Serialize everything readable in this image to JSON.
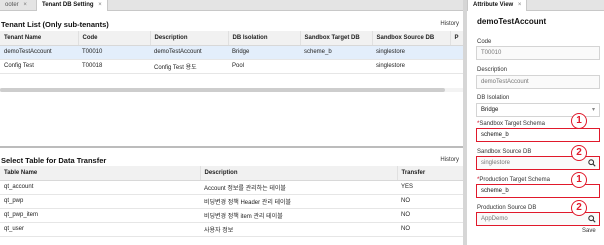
{
  "tabs": [
    {
      "label": "ooter",
      "active": false
    },
    {
      "label": "Tenant DB Setting",
      "active": true
    }
  ],
  "tenant_list": {
    "title": "Tenant List (Only sub-tenants)",
    "history_label": "History",
    "columns": [
      "Tenant Name",
      "Code",
      "Description",
      "DB Isolation",
      "Sandbox Target DB",
      "Sandbox Source DB",
      "P"
    ],
    "rows": [
      {
        "name": "demoTestAccount",
        "code": "T00010",
        "description": "demoTestAccount",
        "isolation": "Bridge",
        "sandbox_target": "scheme_b",
        "sandbox_source": "singlestore",
        "p": "",
        "selected": true
      },
      {
        "name": "Config Test",
        "code": "T00018",
        "description": "Config Test 용도",
        "isolation": "Pool",
        "sandbox_target": "",
        "sandbox_source": "singlestore",
        "p": "",
        "selected": false
      }
    ]
  },
  "transfer_tables": {
    "title": "Select Table for Data Transfer",
    "history_label": "History",
    "columns": [
      "Table Name",
      "Description",
      "Transfer"
    ],
    "rows": [
      {
        "name": "qt_account",
        "description": "Account 정보를 관리하는 테이블",
        "transfer": "YES"
      },
      {
        "name": "qt_pwp",
        "description": "비딩변경 정책 Header 관리 테이블",
        "transfer": "NO"
      },
      {
        "name": "qt_pwp_item",
        "description": "비딩변경 정책 item 관리 테이블",
        "transfer": "NO"
      },
      {
        "name": "qt_user",
        "description": "사용자 정보",
        "transfer": "NO"
      }
    ]
  },
  "attribute_view": {
    "tab_label": "Attribute View",
    "title": "demoTestAccount",
    "fields": {
      "code": {
        "label": "Code",
        "value": "T00010"
      },
      "description": {
        "label": "Description",
        "value": "demoTestAccount"
      },
      "db_isolation": {
        "label": "DB Isolation",
        "value": "Bridge"
      },
      "sandbox_target_schema": {
        "required_mark": "*",
        "label": "Sandbox Target Schema",
        "value": "scheme_b"
      },
      "sandbox_source_db": {
        "label": "Sandbox Source DB",
        "value": "singlestore"
      },
      "production_target_schema": {
        "required_mark": "*",
        "label": "Production Target Schema",
        "value": "scheme_b"
      },
      "production_source_db": {
        "label": "Production Source DB",
        "value": "AppDemo"
      }
    },
    "save_label": "Save"
  },
  "annotations": [
    "1",
    "2",
    "1",
    "2"
  ],
  "colors": {
    "highlight": "#e0192b",
    "selected_row": "#e3eefb",
    "header_bg": "#f1f1f1"
  }
}
